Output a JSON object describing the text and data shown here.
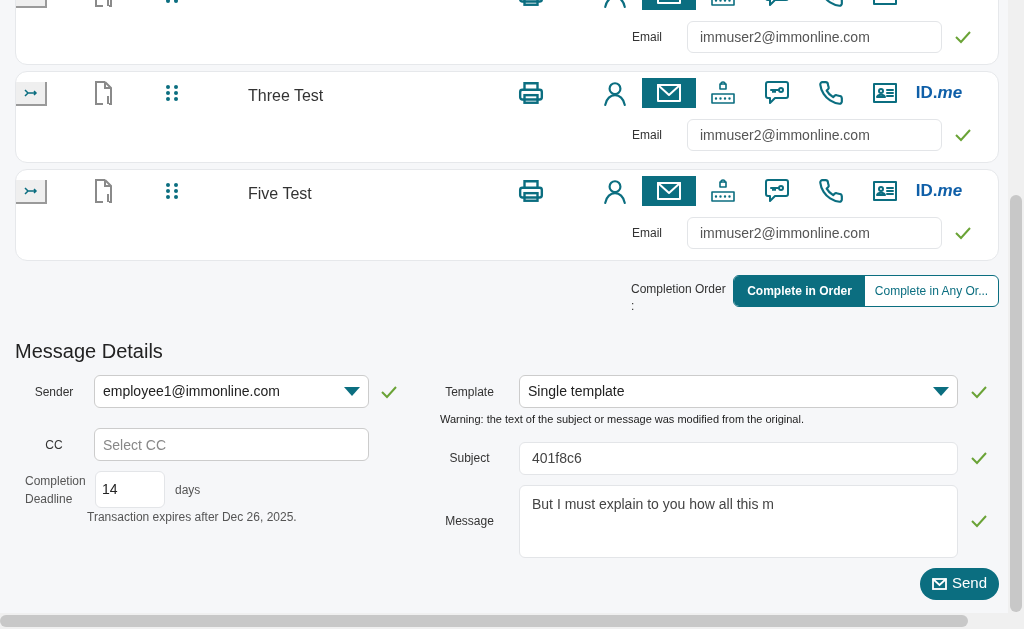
{
  "signers": [
    {
      "tools": [
        {
          "kind": "person",
          "selected": false
        },
        {
          "kind": "email",
          "selected": true
        },
        {
          "kind": "keypad",
          "selected": false
        },
        {
          "kind": "chat-key",
          "selected": false
        },
        {
          "kind": "phone",
          "selected": false
        },
        {
          "kind": "id-card",
          "selected": false
        }
      ],
      "email_label": "Email",
      "email": "immuser2@immonline.com",
      "verified": true
    },
    {
      "name": "Three Test",
      "tools": [
        {
          "kind": "person",
          "selected": false
        },
        {
          "kind": "email",
          "selected": true
        },
        {
          "kind": "keypad",
          "selected": false
        },
        {
          "kind": "chat-key",
          "selected": false
        },
        {
          "kind": "phone",
          "selected": false
        },
        {
          "kind": "id-card",
          "selected": false
        },
        {
          "kind": "idme",
          "selected": false,
          "label": "ID.*me*"
        }
      ],
      "email_label": "Email",
      "email": "immuser2@immonline.com",
      "verified": true
    },
    {
      "name": "Five Test",
      "tools": [
        {
          "kind": "person",
          "selected": false
        },
        {
          "kind": "email",
          "selected": true
        },
        {
          "kind": "keypad",
          "selected": false
        },
        {
          "kind": "chat-key",
          "selected": false
        },
        {
          "kind": "phone",
          "selected": false
        },
        {
          "kind": "id-card",
          "selected": false
        },
        {
          "kind": "idme",
          "selected": false,
          "label": "ID.*me*"
        }
      ],
      "email_label": "Email",
      "email": "immuser2@immonline.com",
      "verified": true
    }
  ],
  "completion_order": {
    "label": "Completion Order :",
    "options": [
      {
        "label": "Complete in Order",
        "selected": true
      },
      {
        "label": "Complete in Any Or...",
        "selected": false
      }
    ]
  },
  "message_details": {
    "title": "Message Details",
    "sender": {
      "label": "Sender",
      "value": "employee1@immonline.com",
      "verified": true
    },
    "cc": {
      "label": "CC",
      "placeholder": "Select CC"
    },
    "deadline": {
      "label": "Completion Deadline",
      "value": "14",
      "unit": "days",
      "note": "Transaction expires after Dec 26, 2025."
    },
    "template": {
      "label": "Template",
      "value": "Single template",
      "verified": true
    },
    "warning": "Warning: the text of the subject or message was modified from the original.",
    "subject": {
      "label": "Subject",
      "value": "401f8c6",
      "verified": true
    },
    "message": {
      "label": "Message",
      "value": "But I must explain to you how all this m",
      "verified": true
    }
  },
  "send_button": "Send"
}
